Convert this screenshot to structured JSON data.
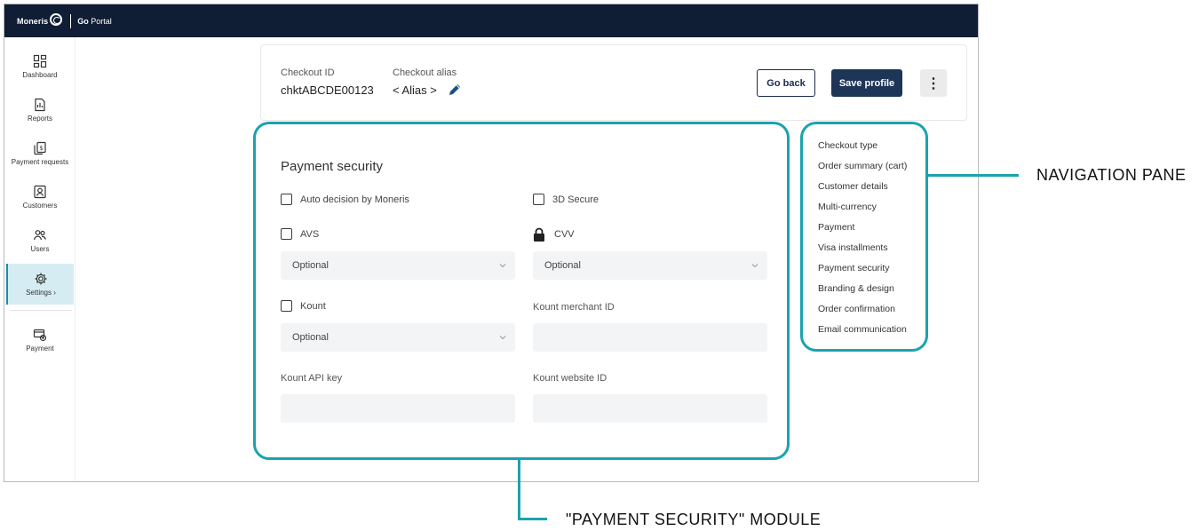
{
  "topbar": {
    "brand": "Moneris",
    "portal_bold": "Go",
    "portal_text": "Portal"
  },
  "sidebar": {
    "items": [
      {
        "label": "Dashboard",
        "icon": "dashboard-icon"
      },
      {
        "label": "Reports",
        "icon": "reports-icon"
      },
      {
        "label": "Payment requests",
        "icon": "payment-requests-icon"
      },
      {
        "label": "Customers",
        "icon": "customers-icon"
      },
      {
        "label": "Users",
        "icon": "users-icon"
      },
      {
        "label": "Settings ›",
        "icon": "gear-icon",
        "active": true
      },
      {
        "label": "Payment",
        "icon": "payment-icon"
      }
    ]
  },
  "header": {
    "checkout_id_label": "Checkout ID",
    "checkout_id_value": "chktABCDE00123",
    "alias_label": "Checkout alias",
    "alias_value": "< Alias >",
    "go_back_label": "Go back",
    "save_label": "Save profile",
    "more_label": "⋮"
  },
  "payment_security": {
    "title": "Payment security",
    "auto_decision_label": "Auto decision by Moneris",
    "secure3d_label": "3D Secure",
    "avs_label": "AVS",
    "avs_value": "Optional",
    "cvv_label": "CVV",
    "cvv_value": "Optional",
    "kount_label": "Kount",
    "kount_value": "Optional",
    "kount_merchant_label": "Kount merchant ID",
    "kount_api_label": "Kount API key",
    "kount_website_label": "Kount website ID"
  },
  "nav_pane": {
    "links": [
      "Checkout type",
      "Order summary (cart)",
      "Customer details",
      "Multi-currency",
      "Payment",
      "Visa installments",
      "Payment security",
      "Branding & design",
      "Order confirmation",
      "Email communication"
    ]
  },
  "annotations": {
    "nav_pane_label": "NAVIGATION PANE",
    "module_label": "\"PAYMENT SECURITY\" MODULE"
  },
  "colors": {
    "topbar": "#0f1d35",
    "primary_button": "#1d3557",
    "annotation": "#1aa3ae",
    "sidebar_active": "#d6ecf3"
  }
}
